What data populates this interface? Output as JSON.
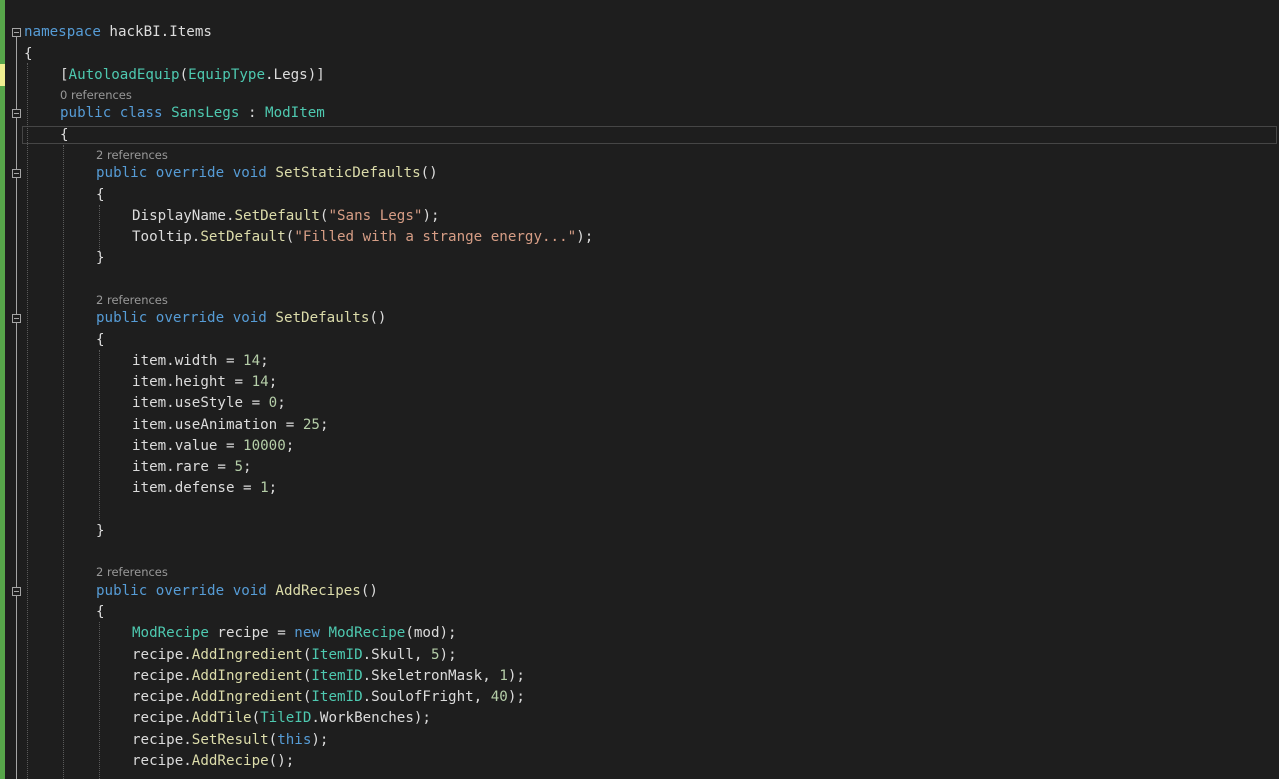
{
  "code": {
    "ns_kw": "namespace",
    "ns_name": " hackBI.Items",
    "ob1": "{",
    "attr_open": "[",
    "attr_name": "AutoloadEquip",
    "attr_paren": "(",
    "attr_type": "EquipType",
    "attr_val": ".Legs)]",
    "refs0": "0 references",
    "cls_public": "public",
    "cls_class": "class",
    "cls_name": "SansLegs",
    "cls_colon": " : ",
    "cls_base": "ModItem",
    "ob2": "{",
    "refs1": "2 references",
    "m1_public": "public",
    "m1_override": "override",
    "m1_void": "void",
    "m1_name": "SetStaticDefaults",
    "m1_parens": "()",
    "m1_ob": "{",
    "dn_obj": "DisplayName.",
    "dn_method": "SetDefault",
    "dn_open": "(",
    "dn_str": "\"Sans Legs\"",
    "dn_close": ");",
    "tt_obj": "Tooltip.",
    "tt_method": "SetDefault",
    "tt_open": "(",
    "tt_str": "\"Filled with a strange energy...\"",
    "tt_close": ");",
    "m1_cb": "}",
    "refs2": "2 references",
    "m2_public": "public",
    "m2_override": "override",
    "m2_void": "void",
    "m2_name": "SetDefaults",
    "m2_parens": "()",
    "m2_ob": "{",
    "l_width": "item.width = ",
    "v_width": "14",
    "l_height": "item.height = ",
    "v_height": "14",
    "l_usestyle": "item.useStyle = ",
    "v_usestyle": "0",
    "l_useanim": "item.useAnimation = ",
    "v_useanim": "25",
    "l_value": "item.value = ",
    "v_value": "10000",
    "l_rare": "item.rare = ",
    "v_rare": "5",
    "l_defense": "item.defense = ",
    "v_defense": "1",
    "semi": ";",
    "m2_cb": "}",
    "refs3": "2 references",
    "m3_public": "public",
    "m3_override": "override",
    "m3_void": "void",
    "m3_name": "AddRecipes",
    "m3_parens": "()",
    "m3_ob": "{",
    "r_type": "ModRecipe",
    "r_var": " recipe = ",
    "r_new": "new",
    "r_ctor": "ModRecipe",
    "r_args": "(mod);",
    "recipe": "recipe.",
    "add_ing": "AddIngredient",
    "itemid": "ItemID",
    "ing1_name": ".Skull, ",
    "ing1_qty": "5",
    "ing2_name": ".SkeletronMask, ",
    "ing2_qty": "1",
    "ing3_name": ".SoulofFright, ",
    "ing3_qty": "40",
    "close_paren": ");",
    "add_tile": "AddTile",
    "tileid": "TileID",
    "tile_name": ".WorkBenches);",
    "set_result": "SetResult",
    "this_kw": "this",
    "add_recipe": "AddRecipe",
    "empty_call": "();",
    "open_paren": "("
  }
}
